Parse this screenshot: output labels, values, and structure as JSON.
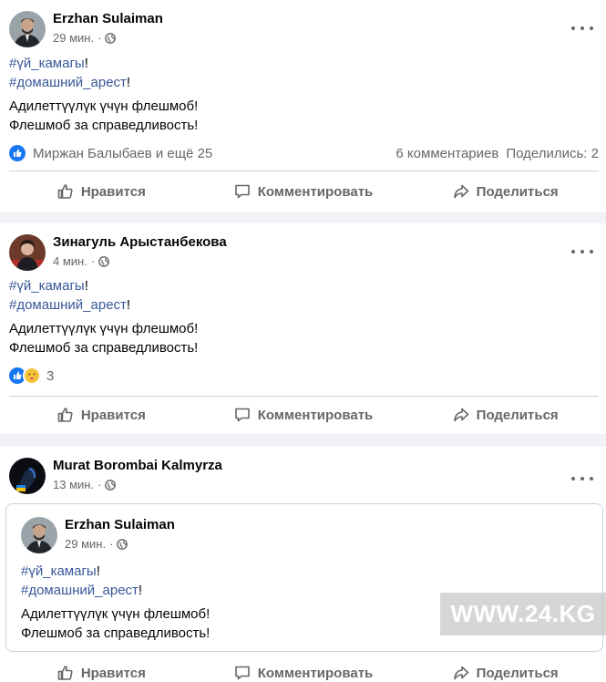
{
  "posts": [
    {
      "author": "Erzhan Sulaiman",
      "time": "29 мин.",
      "dot": "·",
      "tag1": "#үй_камагы",
      "tag2": "#домашний_арест",
      "excl": "!",
      "line1": "Адилеттүүлүк үчүн флешмоб!",
      "line2": "Флешмоб за справедливость!",
      "reaction_names": "Миржан Балыбаев и ещё 25",
      "comments": "6 комментариев",
      "shares": "Поделились: 2"
    },
    {
      "author": "Зинагуль Арыстанбекова",
      "time": "4 мин.",
      "dot": "·",
      "tag1": "#үй_камагы",
      "tag2": "#домашний_арест",
      "excl": "!",
      "line1": "Адилеттүүлүк үчүн флешмоб!",
      "line2": "Флешмоб за справедливость!",
      "reaction_count": "3"
    },
    {
      "author": "Murat Borombai Kalmyrza",
      "time": "13 мин.",
      "dot": "·",
      "shared": {
        "author": "Erzhan Sulaiman",
        "time": "29 мин.",
        "dot": "·",
        "tag1": "#үй_камагы",
        "tag2": "#домашний_арест",
        "excl": "!",
        "line1": "Адилеттүүлүк үчүн флешмоб!",
        "line2": "Флешмоб за справедливость!"
      }
    }
  ],
  "actions": {
    "like": "Нравится",
    "comment": "Комментировать",
    "share": "Поделиться"
  },
  "watermark": "WWW.24.KG",
  "colors": {
    "link": "#385898",
    "secondary_text": "#65676b",
    "like_blue": "#1877f2",
    "background": "#f0f2f5"
  }
}
